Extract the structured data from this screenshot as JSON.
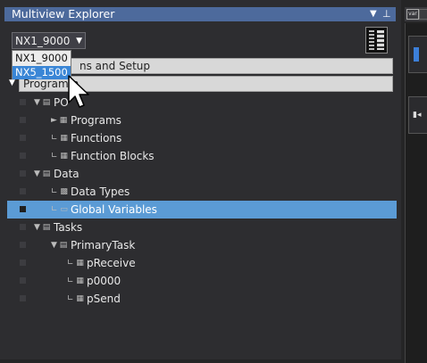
{
  "panel": {
    "title": "Multiview Explorer",
    "pin_icon": "pin-icon",
    "menu_icon": "chevron-down-icon"
  },
  "device_select": {
    "value": "NX1_9000",
    "options": [
      "NX1_9000",
      "NX5_1500"
    ],
    "highlighted": "NX5_1500"
  },
  "sections": {
    "config": "Configurations and Setup",
    "config_visible": "ns and Setup",
    "programming": "Programming",
    "programming_visible": "Programm"
  },
  "tree": [
    {
      "id": "poe",
      "label": "POUs",
      "label_visible": "PO",
      "prefix": "▼ ▤",
      "indent": 0
    },
    {
      "id": "programs",
      "label": "Programs",
      "prefix": "► ▦",
      "indent": 1
    },
    {
      "id": "functions",
      "label": "Functions",
      "prefix": "∟ ▦",
      "indent": 1
    },
    {
      "id": "function-blocks",
      "label": "Function Blocks",
      "prefix": "∟ ▦",
      "indent": 1
    },
    {
      "id": "data",
      "label": "Data",
      "prefix": "▼ ▤",
      "indent": 0
    },
    {
      "id": "data-types",
      "label": "Data Types",
      "prefix": "∟ ▩",
      "indent": 1
    },
    {
      "id": "global-variables",
      "label": "Global Variables",
      "prefix": "∟ ▭",
      "indent": 1,
      "selected": true
    },
    {
      "id": "tasks",
      "label": "Tasks",
      "prefix": "▼ ▤",
      "indent": 0
    },
    {
      "id": "primary-task",
      "label": "PrimaryTask",
      "prefix": "▼ ▤",
      "indent": 1
    },
    {
      "id": "preceive",
      "label": "pReceive",
      "prefix": "∟ ▦",
      "indent": 2
    },
    {
      "id": "p0000",
      "label": "p0000",
      "prefix": "∟ ▦",
      "indent": 2
    },
    {
      "id": "psend",
      "label": "pSend",
      "prefix": "∟ ▦",
      "indent": 2
    }
  ],
  "colors": {
    "title_bar": "#4d6a9c",
    "selection": "#5b9bd5",
    "panel_bg": "#2d2d30"
  }
}
